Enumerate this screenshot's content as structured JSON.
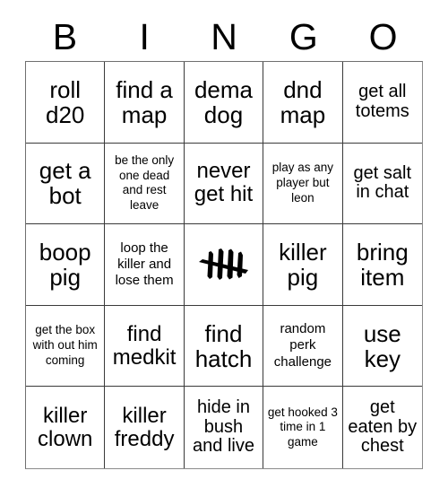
{
  "card": {
    "title": "BINGO",
    "header_letters": [
      "B",
      "I",
      "N",
      "G",
      "O"
    ],
    "grid_size": "5x5",
    "text_color": "#000000",
    "background_color": "#ffffff",
    "border_color": "#3a3a3a",
    "cells": [
      {
        "text": "roll d20",
        "size": "xl",
        "free": false
      },
      {
        "text": "find a map",
        "size": "xl",
        "free": false
      },
      {
        "text": "dema dog",
        "size": "xl",
        "free": false
      },
      {
        "text": "dnd map",
        "size": "xl",
        "free": false
      },
      {
        "text": "get all totems",
        "size": "md",
        "free": false
      },
      {
        "text": "get a bot",
        "size": "xl",
        "free": false
      },
      {
        "text": "be the only one dead and rest leave",
        "size": "xs",
        "free": false
      },
      {
        "text": "never get hit",
        "size": "lg",
        "free": false
      },
      {
        "text": "play as any player but leon",
        "size": "xs",
        "free": false
      },
      {
        "text": "get salt in chat",
        "size": "md",
        "free": false
      },
      {
        "text": "boop pig",
        "size": "xl",
        "free": false
      },
      {
        "text": "loop the killer and lose them",
        "size": "sm",
        "free": false
      },
      {
        "text": "",
        "size": "md",
        "free": true,
        "icon": "dbd-tally-logo"
      },
      {
        "text": "killer pig",
        "size": "xl",
        "free": false
      },
      {
        "text": "bring item",
        "size": "xl",
        "free": false
      },
      {
        "text": "get the box with out him coming",
        "size": "xs",
        "free": false
      },
      {
        "text": "find medkit",
        "size": "lg",
        "free": false
      },
      {
        "text": "find hatch",
        "size": "xl",
        "free": false
      },
      {
        "text": "random perk challenge",
        "size": "sm",
        "free": false
      },
      {
        "text": "use key",
        "size": "xl",
        "free": false
      },
      {
        "text": "killer clown",
        "size": "lg",
        "free": false
      },
      {
        "text": "killer freddy",
        "size": "lg",
        "free": false
      },
      {
        "text": "hide in bush and live",
        "size": "md",
        "free": false
      },
      {
        "text": "get hooked 3 time in 1 game",
        "size": "xs",
        "free": false
      },
      {
        "text": "get eaten by chest",
        "size": "md",
        "free": false
      }
    ]
  }
}
